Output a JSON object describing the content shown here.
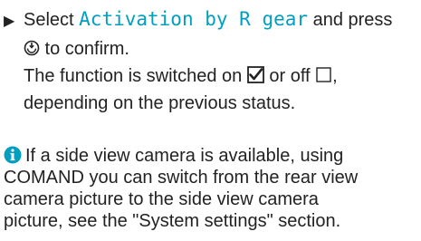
{
  "step": {
    "bullet": "▶",
    "line1_pre": "Select ",
    "menu_item": "Activation by R gear",
    "line1_post": " and press",
    "line2_post": " to confirm.",
    "line3_pre": "The function is switched on ",
    "line3_mid": " or off ",
    "line3_post": ",",
    "line4": "depending on the previous status."
  },
  "info": {
    "line1": "If a side view camera is available, using",
    "line2": "COMAND you can switch from the rear view",
    "line3": "camera picture to the side view camera",
    "line4": "picture, see the \"System settings\" section."
  },
  "colors": {
    "accent": "#009fc0",
    "text": "#222222"
  },
  "icons": {
    "bullet": "triangle-bullet-icon",
    "confirm": "controller-press-icon",
    "checked": "checkbox-checked-icon",
    "unchecked": "checkbox-unchecked-icon",
    "info": "info-icon"
  }
}
